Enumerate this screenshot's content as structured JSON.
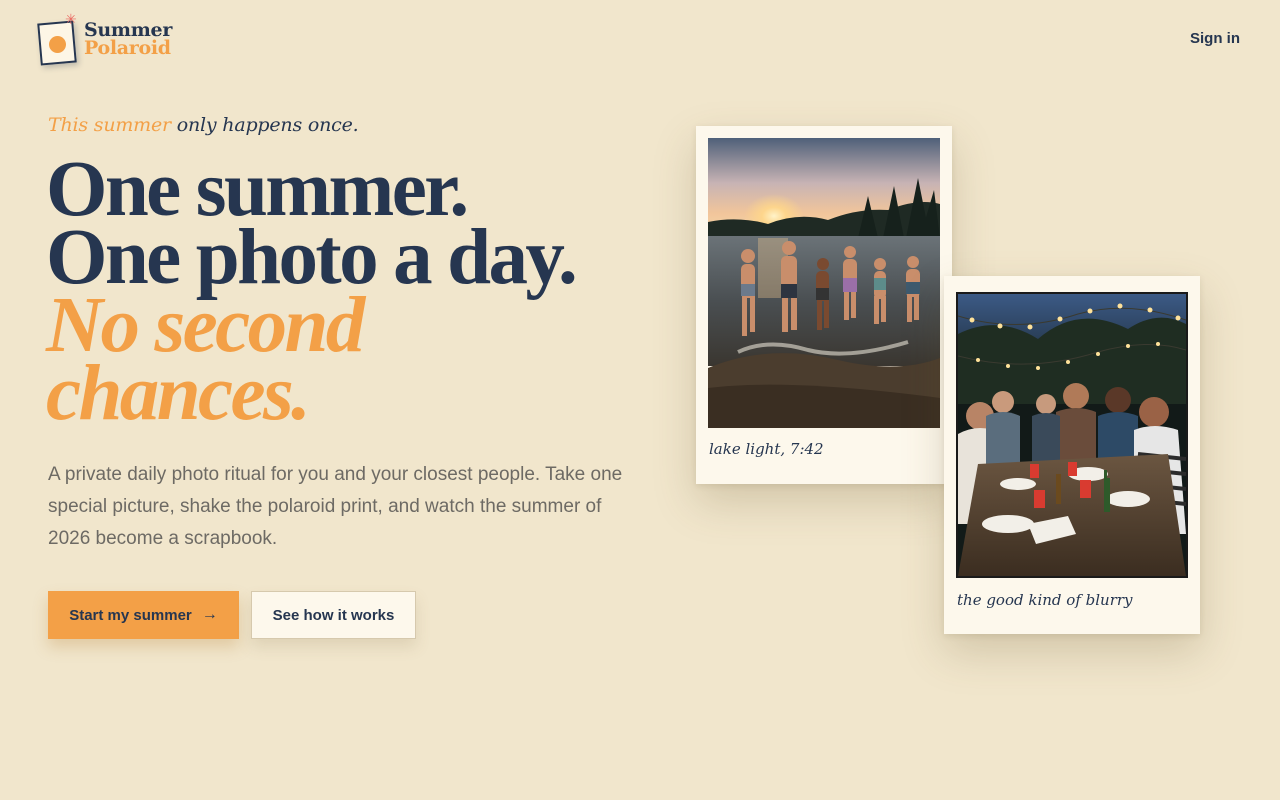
{
  "brand": {
    "name_line1": "Summer",
    "name_line2": "Polaroid"
  },
  "nav": {
    "signin_label": "Sign in"
  },
  "hero": {
    "eyebrow_accent": "This summer",
    "eyebrow_rest": " only happens once.",
    "headline_line1": "One summer.",
    "headline_line2": "One photo a day.",
    "headline_line3": "No second",
    "headline_line4": "chances.",
    "lede": "A private daily photo ritual for you and your closest people. Take one special picture, shake the polaroid print, and watch the summer of 2026 become a scrapbook.",
    "primary_cta": "Start my summer",
    "secondary_cta": "See how it works"
  },
  "polaroids": [
    {
      "caption": "lake light, 7:42"
    },
    {
      "caption": "the good kind of blurry"
    }
  ],
  "colors": {
    "background": "#f1e6cc",
    "navy": "#263650",
    "accent_orange": "#f3a047",
    "paper": "#fdf8ec"
  },
  "icons": {
    "cta_arrow": "arrow-right-icon",
    "logo_sparkle": "sparkle-icon"
  }
}
